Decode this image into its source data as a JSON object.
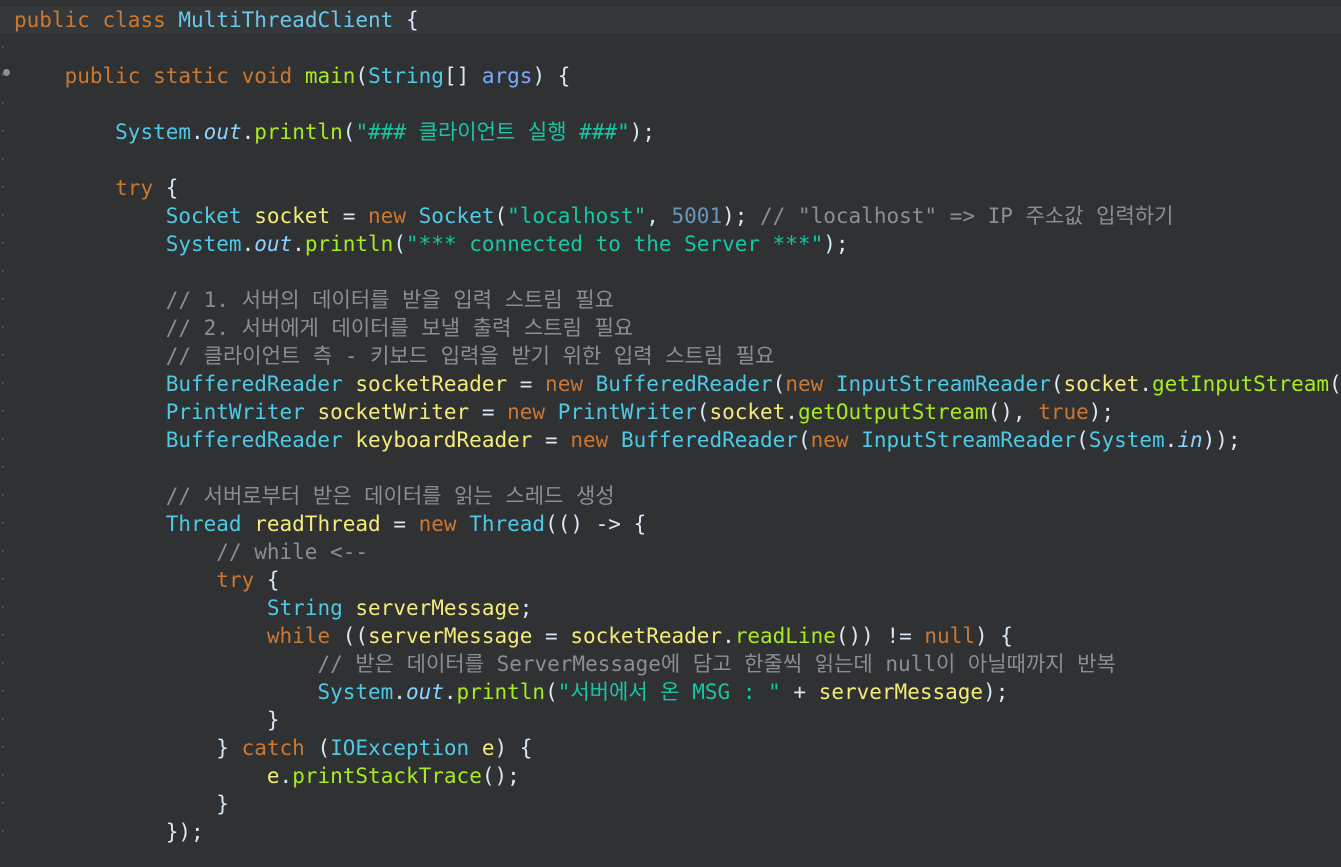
{
  "editor": {
    "language": "java",
    "colors": {
      "background": "#2f3133",
      "keyword": "#cc7832",
      "type": "#4ec9e6",
      "string": "#17c6a3",
      "comment": "#8a8f95",
      "variable": "#f3ec79",
      "method": "#a7ec21"
    },
    "lines": [
      "public class MultiThreadClient {",
      "",
      "    public static void main(String[] args) {",
      "",
      "        System.out.println(\"### 클라이언트 실행 ###\");",
      "",
      "        try {",
      "            Socket socket = new Socket(\"localhost\", 5001); // \"localhost\" => IP 주소값 입력하기",
      "            System.out.println(\"*** connected to the Server ***\");",
      "",
      "            // 1. 서버의 데이터를 받을 입력 스트림 필요",
      "            // 2. 서버에게 데이터를 보낼 출력 스트림 필요",
      "            // 클라이언트 측 - 키보드 입력을 받기 위한 입력 스트림 필요",
      "            BufferedReader socketReader = new BufferedReader(new InputStreamReader(socket.getInputStream()));",
      "            PrintWriter socketWriter = new PrintWriter(socket.getOutputStream(), true);",
      "            BufferedReader keyboardReader = new BufferedReader(new InputStreamReader(System.in));",
      "",
      "            // 서버로부터 받은 데이터를 읽는 스레드 생성",
      "            Thread readThread = new Thread(() -> {",
      "                // while <--",
      "                try {",
      "                    String serverMessage;",
      "                    while ((serverMessage = socketReader.readLine()) != null) {",
      "                        // 받은 데이터를 ServerMessage에 담고 한줄씩 읽는데 null이 아닐때까지 반복",
      "                        System.out.println(\"서버에서 온 MSG : \" + serverMessage);",
      "                    }",
      "                } catch (IOException e) {",
      "                    e.printStackTrace();",
      "                }",
      "            });"
    ]
  }
}
